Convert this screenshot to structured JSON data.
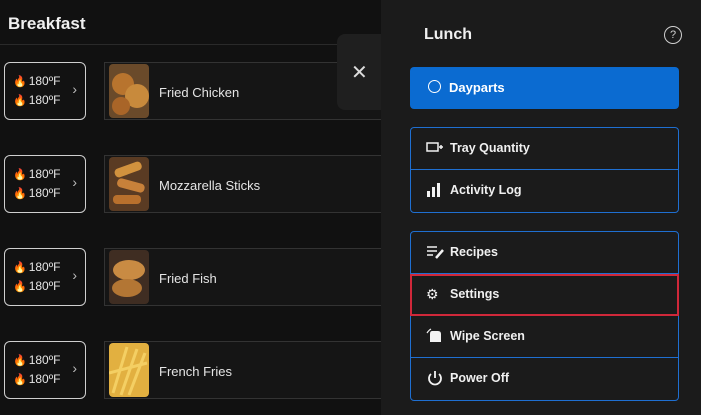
{
  "left": {
    "title": "Breakfast",
    "rows": [
      {
        "temp1": "180ºF",
        "temp2": "180ºF",
        "name": "Fried Chicken",
        "image": "fried-chicken"
      },
      {
        "temp1": "180ºF",
        "temp2": "180ºF",
        "name": "Mozzarella Sticks",
        "image": "mozzarella-sticks"
      },
      {
        "temp1": "180ºF",
        "temp2": "180ºF",
        "name": "Fried Fish",
        "image": "fried-fish"
      },
      {
        "temp1": "180ºF",
        "temp2": "180ºF",
        "name": "French Fries",
        "image": "french-fries"
      }
    ]
  },
  "panel": {
    "title": "Lunch",
    "primary": {
      "label": "Dayparts",
      "icon": "clock-icon"
    },
    "group1": [
      {
        "label": "Tray Quantity",
        "icon": "tray-plus-icon"
      },
      {
        "label": "Activity Log",
        "icon": "bar-chart-icon"
      }
    ],
    "group2": [
      {
        "label": "Recipes",
        "icon": "list-edit-icon"
      },
      {
        "label": "Settings",
        "icon": "gear-icon"
      },
      {
        "label": "Wipe Screen",
        "icon": "hand-wipe-icon"
      },
      {
        "label": "Power Off",
        "icon": "power-icon"
      }
    ],
    "selected_item": "Settings"
  },
  "colors": {
    "primary": "#0b6bd1",
    "highlight": "#d0283a",
    "group_border": "#1f6fd1"
  }
}
